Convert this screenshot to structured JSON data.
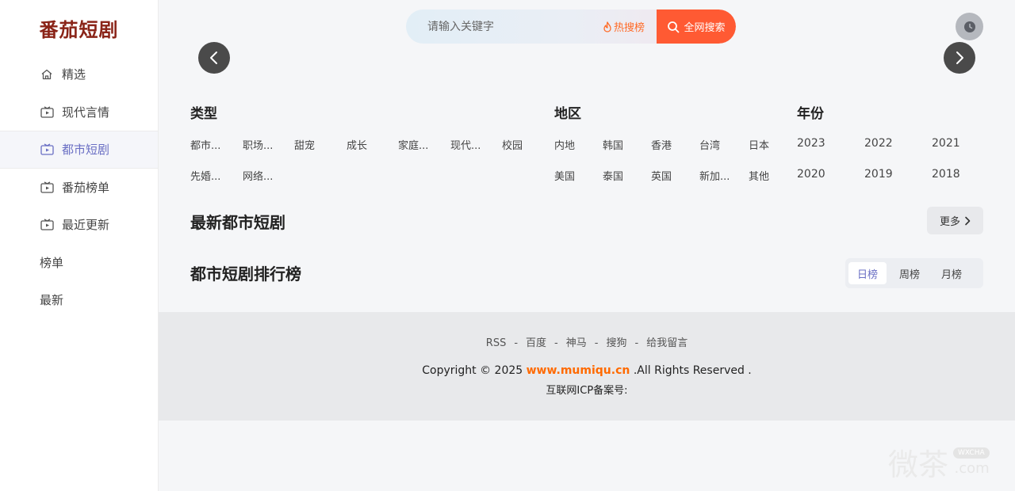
{
  "brand": {
    "title": "番茄短剧"
  },
  "sidebar": {
    "items": [
      {
        "label": "精选",
        "icon": "home-icon"
      },
      {
        "label": "现代言情",
        "icon": "tv-play-icon"
      },
      {
        "label": "都市短剧",
        "icon": "tv-play-icon",
        "active": true
      },
      {
        "label": "番茄榜单",
        "icon": "tv-play-icon"
      },
      {
        "label": "最近更新",
        "icon": "tv-play-icon"
      },
      {
        "label": "榜单"
      },
      {
        "label": "最新"
      }
    ]
  },
  "search": {
    "placeholder": "请输入关键字",
    "hot_label": "热搜榜",
    "button_label": "全网搜索"
  },
  "filters": {
    "type": {
      "heading": "类型",
      "tags": [
        "都市...",
        "职场...",
        "甜宠",
        "成长",
        "家庭...",
        "现代...",
        "校园",
        "先婚...",
        "网络..."
      ]
    },
    "region": {
      "heading": "地区",
      "tags": [
        "内地",
        "韩国",
        "香港",
        "台湾",
        "日本",
        "美国",
        "泰国",
        "英国",
        "新加...",
        "其他"
      ]
    },
    "year": {
      "heading": "年份",
      "tags": [
        "2023",
        "2022",
        "2021",
        "2020",
        "2019",
        "2018"
      ]
    }
  },
  "sections": {
    "latest": {
      "title": "最新都市短剧",
      "more_label": "更多"
    },
    "ranking": {
      "title": "都市短剧排行榜",
      "tabs": [
        "日榜",
        "周榜",
        "月榜"
      ],
      "active_tab": "日榜"
    }
  },
  "footer": {
    "links": [
      "RSS",
      "百度",
      "神马",
      "搜狗",
      "给我留言"
    ],
    "separator": "-",
    "copyright_prefix": "Copyright © 2025",
    "domain": "www.mumiqu.cn",
    "copyright_suffix": ".All Rights Reserved .",
    "icp": "互联网ICP备案号:"
  },
  "watermark": {
    "text": "微茶",
    "badge": "WXCHA",
    "sub": ".com"
  },
  "colors": {
    "brand": "#8a2418",
    "accent": "#6a6fc4",
    "search_button": "#ff5a33",
    "hot": "#ff6a26",
    "domain": "#ff6a00"
  }
}
